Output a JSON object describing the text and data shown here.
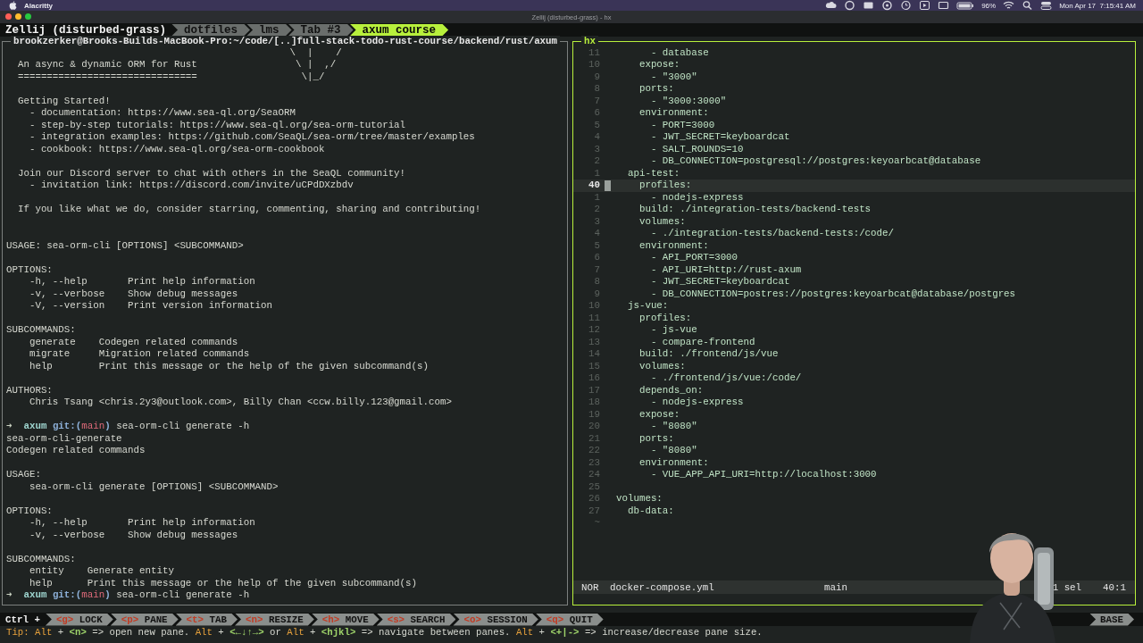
{
  "menu_bar": {
    "app": "Alacritty",
    "battery": "96%",
    "clock": "Mon Apr 17  7:15:41 AM"
  },
  "window": {
    "title": "Zellij (disturbed-grass) - hx"
  },
  "session": "Zellij (disturbed-grass)",
  "tabs": [
    {
      "label": "dotfiles",
      "selected": false
    },
    {
      "label": "lms",
      "selected": false
    },
    {
      "label": "Tab #3",
      "selected": false
    },
    {
      "label": "axum course",
      "selected": true
    }
  ],
  "terminal_pane": {
    "title": "brookzerker@Brooks-Builds-MacBook-Pro:~/code/[..]full-stack-todo-rust-course/backend/rust/axum",
    "focused": false,
    "lines": [
      {
        "kind": "text",
        "text": "                                                 \\  |    /"
      },
      {
        "kind": "text",
        "text": "  An async & dynamic ORM for Rust                 \\ |  ,/"
      },
      {
        "kind": "text",
        "text": "  ===============================                  \\|_/"
      },
      {
        "kind": "blank"
      },
      {
        "kind": "text",
        "text": "  Getting Started!"
      },
      {
        "kind": "text",
        "text": "    - documentation: https://www.sea-ql.org/SeaORM"
      },
      {
        "kind": "text",
        "text": "    - step-by-step tutorials: https://www.sea-ql.org/sea-orm-tutorial"
      },
      {
        "kind": "text",
        "text": "    - integration examples: https://github.com/SeaQL/sea-orm/tree/master/examples"
      },
      {
        "kind": "text",
        "text": "    - cookbook: https://www.sea-ql.org/sea-orm-cookbook"
      },
      {
        "kind": "blank"
      },
      {
        "kind": "text",
        "text": "  Join our Discord server to chat with others in the SeaQL community!"
      },
      {
        "kind": "text",
        "text": "    - invitation link: https://discord.com/invite/uCPdDXzbdv"
      },
      {
        "kind": "blank"
      },
      {
        "kind": "text",
        "text": "  If you like what we do, consider starring, commenting, sharing and contributing!"
      },
      {
        "kind": "blank"
      },
      {
        "kind": "blank"
      },
      {
        "kind": "text",
        "text": "USAGE: sea-orm-cli [OPTIONS] <SUBCOMMAND>"
      },
      {
        "kind": "blank"
      },
      {
        "kind": "text",
        "text": "OPTIONS:"
      },
      {
        "kind": "text",
        "text": "    -h, --help       Print help information"
      },
      {
        "kind": "text",
        "text": "    -v, --verbose    Show debug messages"
      },
      {
        "kind": "text",
        "text": "    -V, --version    Print version information"
      },
      {
        "kind": "blank"
      },
      {
        "kind": "text",
        "text": "SUBCOMMANDS:"
      },
      {
        "kind": "text",
        "text": "    generate    Codegen related commands"
      },
      {
        "kind": "text",
        "text": "    migrate     Migration related commands"
      },
      {
        "kind": "text",
        "text": "    help        Print this message or the help of the given subcommand(s)"
      },
      {
        "kind": "blank"
      },
      {
        "kind": "text",
        "text": "AUTHORS:"
      },
      {
        "kind": "text",
        "text": "    Chris Tsang <chris.2y3@outlook.com>, Billy Chan <ccw.billy.123@gmail.com>"
      },
      {
        "kind": "blank"
      },
      {
        "kind": "prompt",
        "parts": [
          {
            "kind": "arrow",
            "text": "➜  "
          },
          {
            "kind": "dir",
            "text": "axum "
          },
          {
            "kind": "git",
            "text": "git:("
          },
          {
            "kind": "branch",
            "text": "main"
          },
          {
            "kind": "git",
            "text": ")"
          },
          {
            "kind": "plain",
            "text": " sea-orm-cli generate -h"
          }
        ]
      },
      {
        "kind": "text",
        "text": "sea-orm-cli-generate"
      },
      {
        "kind": "text",
        "text": "Codegen related commands"
      },
      {
        "kind": "blank"
      },
      {
        "kind": "text",
        "text": "USAGE:"
      },
      {
        "kind": "text",
        "text": "    sea-orm-cli generate [OPTIONS] <SUBCOMMAND>"
      },
      {
        "kind": "blank"
      },
      {
        "kind": "text",
        "text": "OPTIONS:"
      },
      {
        "kind": "text",
        "text": "    -h, --help       Print help information"
      },
      {
        "kind": "text",
        "text": "    -v, --verbose    Show debug messages"
      },
      {
        "kind": "blank"
      },
      {
        "kind": "text",
        "text": "SUBCOMMANDS:"
      },
      {
        "kind": "text",
        "text": "    entity    Generate entity"
      },
      {
        "kind": "text",
        "text": "    help      Print this message or the help of the given subcommand(s)"
      },
      {
        "kind": "prompt",
        "parts": [
          {
            "kind": "arrow",
            "text": "➜  "
          },
          {
            "kind": "dir",
            "text": "axum "
          },
          {
            "kind": "git",
            "text": "git:("
          },
          {
            "kind": "branch",
            "text": "main"
          },
          {
            "kind": "git",
            "text": ")"
          },
          {
            "kind": "plain",
            "text": " sea-orm-cli generate -h"
          }
        ]
      }
    ]
  },
  "editor_pane": {
    "title": "hx",
    "focused": true,
    "lines": [
      {
        "number": "11",
        "text": "      - database",
        "current": false
      },
      {
        "number": "10",
        "text": "    expose:",
        "current": false
      },
      {
        "number": "9",
        "text": "      - \"3000\"",
        "current": false
      },
      {
        "number": "8",
        "text": "    ports:",
        "current": false
      },
      {
        "number": "7",
        "text": "      - \"3000:3000\"",
        "current": false
      },
      {
        "number": "6",
        "text": "    environment:",
        "current": false
      },
      {
        "number": "5",
        "text": "      - PORT=3000",
        "current": false
      },
      {
        "number": "4",
        "text": "      - JWT_SECRET=keyboardcat",
        "current": false
      },
      {
        "number": "3",
        "text": "      - SALT_ROUNDS=10",
        "current": false
      },
      {
        "number": "2",
        "text": "      - DB_CONNECTION=postgresql://postgres:keyoarbcat@database",
        "current": false
      },
      {
        "number": "1",
        "text": "  api-test:",
        "current": false
      },
      {
        "number": "40",
        "text": "    profiles:",
        "current": true
      },
      {
        "number": "1",
        "text": "      - nodejs-express",
        "current": false
      },
      {
        "number": "2",
        "text": "    build: ./integration-tests/backend-tests",
        "current": false
      },
      {
        "number": "3",
        "text": "    volumes:",
        "current": false
      },
      {
        "number": "4",
        "text": "      - ./integration-tests/backend-tests:/code/",
        "current": false
      },
      {
        "number": "5",
        "text": "    environment:",
        "current": false
      },
      {
        "number": "6",
        "text": "      - API_PORT=3000",
        "current": false
      },
      {
        "number": "7",
        "text": "      - API_URI=http://rust-axum",
        "current": false
      },
      {
        "number": "8",
        "text": "      - JWT_SECRET=keyboardcat",
        "current": false
      },
      {
        "number": "9",
        "text": "      - DB_CONNECTION=postres://postgres:keyoarbcat@database/postgres",
        "current": false
      },
      {
        "number": "10",
        "text": "  js-vue:",
        "current": false
      },
      {
        "number": "11",
        "text": "    profiles:",
        "current": false
      },
      {
        "number": "12",
        "text": "      - js-vue",
        "current": false
      },
      {
        "number": "13",
        "text": "      - compare-frontend",
        "current": false
      },
      {
        "number": "14",
        "text": "    build: ./frontend/js/vue",
        "current": false
      },
      {
        "number": "15",
        "text": "    volumes:",
        "current": false
      },
      {
        "number": "16",
        "text": "      - ./frontend/js/vue:/code/",
        "current": false
      },
      {
        "number": "17",
        "text": "    depends_on:",
        "current": false
      },
      {
        "number": "18",
        "text": "      - nodejs-express",
        "current": false
      },
      {
        "number": "19",
        "text": "    expose:",
        "current": false
      },
      {
        "number": "20",
        "text": "      - \"8080\"",
        "current": false
      },
      {
        "number": "21",
        "text": "    ports:",
        "current": false
      },
      {
        "number": "22",
        "text": "      - \"8080\"",
        "current": false
      },
      {
        "number": "23",
        "text": "    environment:",
        "current": false
      },
      {
        "number": "24",
        "text": "      - VUE_APP_API_URI=http://localhost:3000",
        "current": false
      },
      {
        "number": "25",
        "current": false
      },
      {
        "number": "26",
        "text": "volumes:",
        "current": false
      },
      {
        "number": "27",
        "text": "  db-data:",
        "current": false
      }
    ],
    "end_marker": "~",
    "status": {
      "mode": "NOR",
      "file": "docker-compose.yml",
      "branch": "main",
      "selections": "1 sel",
      "position": "40:1"
    }
  },
  "key_bar": {
    "modifier": "Ctrl +",
    "hints": [
      {
        "key": "<g>",
        "label": "LOCK"
      },
      {
        "key": "<p>",
        "label": "PANE"
      },
      {
        "key": "<t>",
        "label": "TAB"
      },
      {
        "key": "<n>",
        "label": "RESIZE"
      },
      {
        "key": "<h>",
        "label": "MOVE"
      },
      {
        "key": "<s>",
        "label": "SEARCH"
      },
      {
        "key": "<o>",
        "label": "SESSION"
      },
      {
        "key": "<q>",
        "label": "QUIT"
      }
    ],
    "mode": "BASE"
  },
  "tip": [
    {
      "kind": "label",
      "text": "Tip: "
    },
    {
      "kind": "label",
      "text": "Alt"
    },
    {
      "kind": "plain",
      "text": " + "
    },
    {
      "kind": "key",
      "text": "<n>"
    },
    {
      "kind": "plain",
      "text": " => open new pane. "
    },
    {
      "kind": "label",
      "text": "Alt"
    },
    {
      "kind": "plain",
      "text": " + "
    },
    {
      "kind": "key",
      "text": "<←↓↑→>"
    },
    {
      "kind": "plain",
      "text": " or "
    },
    {
      "kind": "label",
      "text": "Alt"
    },
    {
      "kind": "plain",
      "text": " + "
    },
    {
      "kind": "key",
      "text": "<hjkl>"
    },
    {
      "kind": "plain",
      "text": " => navigate between panes. "
    },
    {
      "kind": "label",
      "text": "Alt"
    },
    {
      "kind": "plain",
      "text": " + "
    },
    {
      "kind": "key",
      "text": "<+|->"
    },
    {
      "kind": "plain",
      "text": " => increase/decrease pane size."
    }
  ]
}
